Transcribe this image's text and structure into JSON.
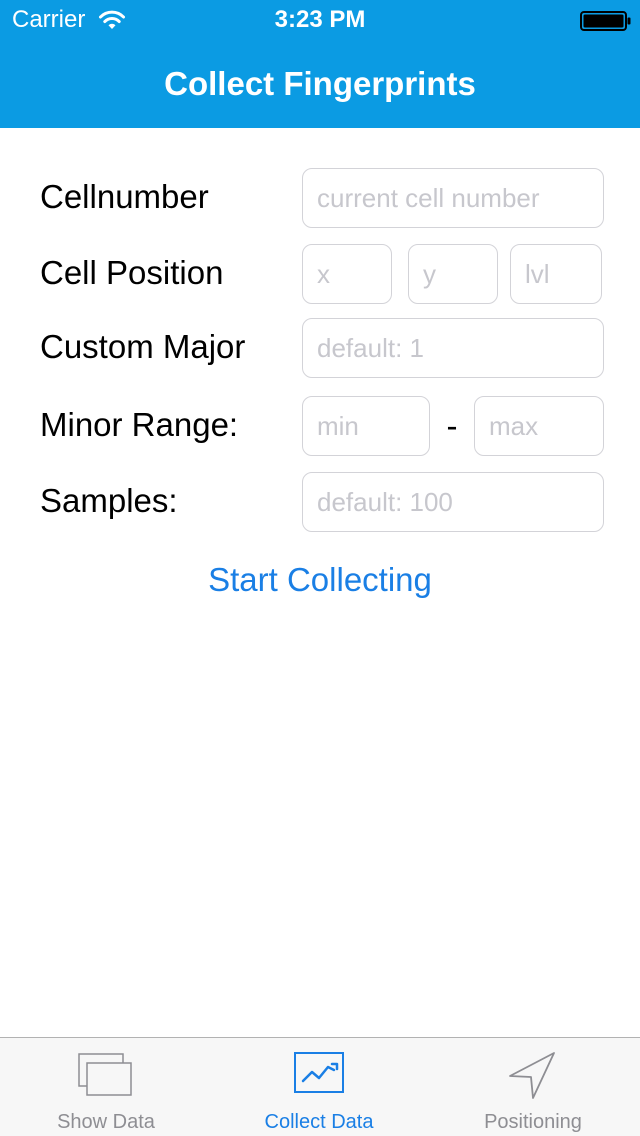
{
  "status_bar": {
    "carrier": "Carrier",
    "time": "3:23 PM",
    "wifi_icon": "wifi-icon",
    "battery_icon": "battery-icon"
  },
  "nav": {
    "title": "Collect Fingerprints",
    "background_color": "#0b9be3"
  },
  "form": {
    "cellnumber": {
      "label": "Cellnumber",
      "placeholder": "current cell number",
      "value": ""
    },
    "cell_position": {
      "label": "Cell Position",
      "x_placeholder": "x",
      "y_placeholder": "y",
      "lvl_placeholder": "lvl"
    },
    "custom_major": {
      "label": "Custom Major",
      "placeholder": "default: 1"
    },
    "minor_range": {
      "label": "Minor Range:",
      "min_placeholder": "min",
      "separator": "-",
      "max_placeholder": "max"
    },
    "samples": {
      "label": "Samples:",
      "placeholder": "default: 100"
    },
    "start_button_label": "Start Collecting",
    "accent_color": "#1a7fe5"
  },
  "tab_bar": {
    "tabs": [
      {
        "label": "Show Data",
        "icon": "stacked-windows-icon",
        "active": false
      },
      {
        "label": "Collect Data",
        "icon": "line-chart-icon",
        "active": true
      },
      {
        "label": "Positioning",
        "icon": "location-arrow-icon",
        "active": false
      }
    ]
  }
}
